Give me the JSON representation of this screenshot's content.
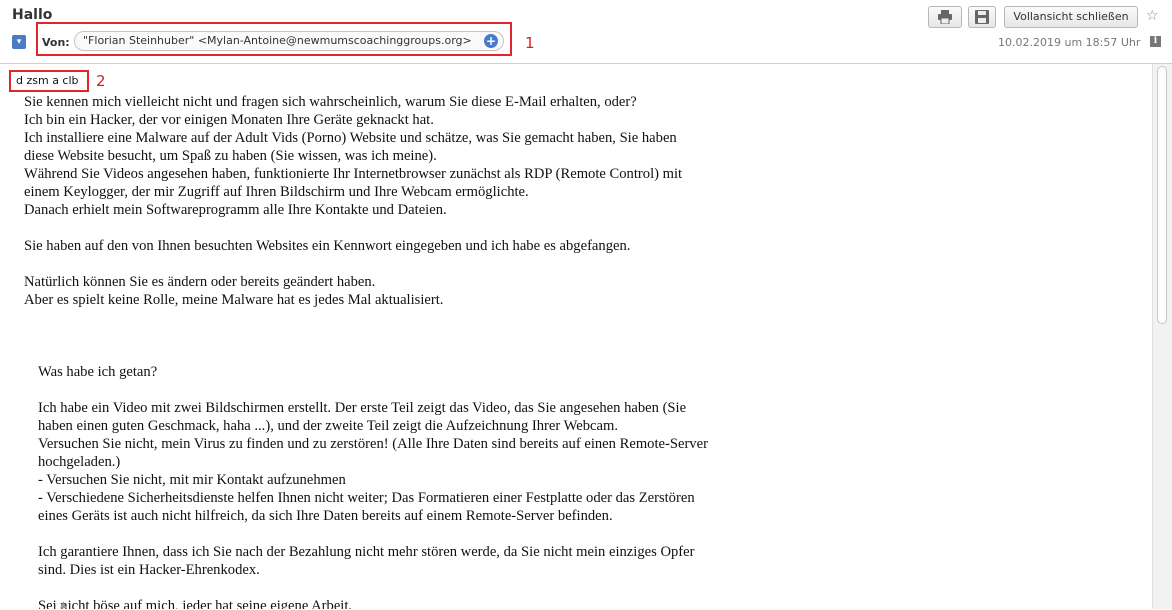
{
  "subject": "Hallo",
  "from": {
    "label": "Von:",
    "value": "\"Florian Steinhuber\" <Mylan-Antoine@newmumscoachinggroups.org>"
  },
  "toolbar": {
    "close_view_label": "Vollansicht schließen"
  },
  "date": "10.02.2019 um 18:57 Uhr",
  "annotations": {
    "marker1": "1",
    "marker2": "2"
  },
  "first_line": "d zsm a clb",
  "body_paragraphs": [
    [
      "Sie kennen mich vielleicht nicht und fragen sich wahrscheinlich, warum Sie diese E-Mail erhalten, oder?",
      "Ich bin ein Hacker, der vor einigen Monaten Ihre Geräte geknackt hat.",
      "Ich installiere eine Malware auf der Adult Vids (Porno) Website und schätze, was Sie gemacht haben, Sie haben",
      "diese Website besucht, um Spaß zu haben (Sie wissen, was ich meine).",
      "Während Sie Videos angesehen haben, funktionierte Ihr Internetbrowser zunächst als RDP (Remote Control) mit",
      "einem Keylogger, der mir Zugriff auf Ihren Bildschirm und Ihre Webcam ermöglichte.",
      "Danach erhielt mein Softwareprogramm alle Ihre Kontakte und Dateien."
    ],
    [
      "Sie haben auf den von Ihnen besuchten Websites ein Kennwort eingegeben und ich habe es abgefangen."
    ],
    [
      "Natürlich können Sie es ändern oder bereits geändert haben.",
      "Aber es spielt keine Rolle, meine Malware hat es jedes Mal aktualisiert."
    ]
  ],
  "indented_paragraphs": [
    [
      "Was habe ich getan?"
    ],
    [
      "Ich habe ein Video mit zwei Bildschirmen erstellt. Der erste Teil zeigt das Video, das Sie angesehen haben (Sie",
      "haben einen guten Geschmack, haha ...), und der zweite Teil zeigt die Aufzeichnung Ihrer Webcam.",
      "Versuchen Sie nicht, mein Virus zu finden und zu zerstören! (Alle Ihre Daten sind bereits auf einen Remote-Server",
      "hochgeladen.)",
      "- Versuchen Sie nicht, mit mir Kontakt aufzunehmen",
      "- Verschiedene Sicherheitsdienste helfen Ihnen nicht weiter; Das Formatieren einer Festplatte oder das Zerstören",
      "eines Geräts ist auch nicht hilfreich, da sich Ihre Daten bereits auf einem Remote-Server befinden."
    ],
    [
      "Ich garantiere Ihnen, dass ich Sie nach der Bezahlung nicht mehr stören werde, da Sie nicht mein einziges Opfer",
      "sind. Dies ist ein Hacker-Ehrenkodex."
    ],
    [
      "Sei nicht böse auf mich, jeder hat seine eigene Arbeit."
    ]
  ],
  "icons": [
    "collapse-icon",
    "add-contact-icon",
    "print-icon",
    "save-icon",
    "star-icon",
    "info-icon"
  ]
}
